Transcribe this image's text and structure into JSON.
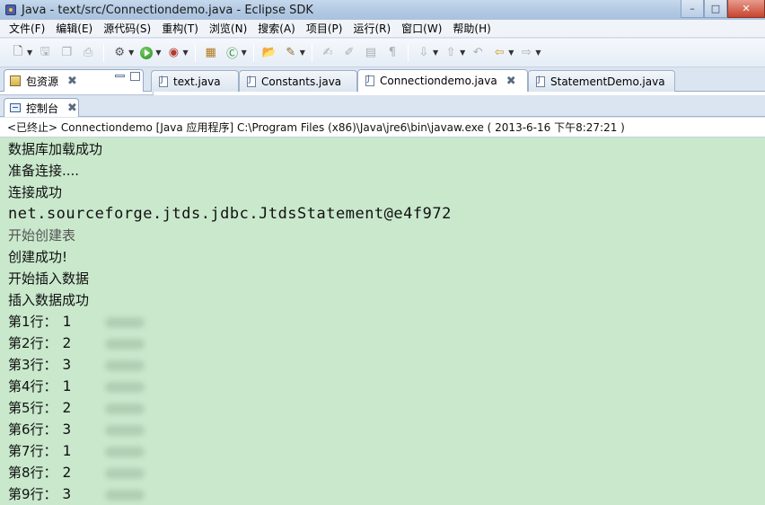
{
  "window": {
    "title": "Java  -  text/src/Connectiondemo.java  -  Eclipse SDK"
  },
  "menu": [
    "文件(F)",
    "编辑(E)",
    "源代码(S)",
    "重构(T)",
    "浏览(N)",
    "搜索(A)",
    "项目(P)",
    "运行(R)",
    "窗口(W)",
    "帮助(H)"
  ],
  "package_explorer": {
    "label": "包资源"
  },
  "editor_tabs": [
    {
      "label": "text.java"
    },
    {
      "label": "Constants.java"
    },
    {
      "label": "Connectiondemo.java"
    },
    {
      "label": "StatementDemo.java"
    }
  ],
  "console": {
    "tab_label": "控制台",
    "status": "<已终止> Connectiondemo [Java 应用程序] C:\\Program Files (x86)\\Java\\jre6\\bin\\javaw.exe ( 2013-6-16 下午8:27:21 )",
    "lines": [
      "数据库加载成功",
      "准备连接....",
      "连接成功",
      "net.sourceforge.jtds.jdbc.JtdsStatement@e4f972",
      "开始创建表",
      "创建成功!",
      "开始插入数据",
      "插入数据成功"
    ],
    "rows": [
      {
        "label": "第1行：",
        "value": "1"
      },
      {
        "label": "第2行：",
        "value": "2"
      },
      {
        "label": "第3行：",
        "value": "3"
      },
      {
        "label": "第4行：",
        "value": "1"
      },
      {
        "label": "第5行：",
        "value": "2"
      },
      {
        "label": "第6行：",
        "value": "3"
      },
      {
        "label": "第7行：",
        "value": "1"
      },
      {
        "label": "第8行：",
        "value": "2"
      },
      {
        "label": "第9行：",
        "value": "3"
      }
    ]
  },
  "colors": {
    "console_bg": "#c9e8cc",
    "title_bar": "#b4cae3"
  }
}
